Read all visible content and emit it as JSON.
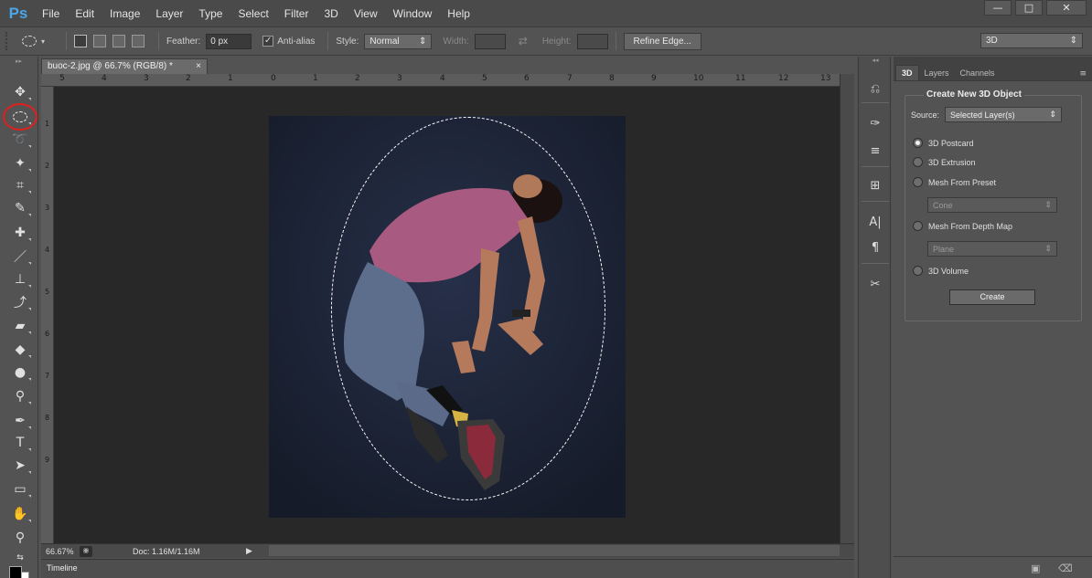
{
  "app": {
    "logo": "Ps",
    "menu": [
      "File",
      "Edit",
      "Image",
      "Layer",
      "Type",
      "Select",
      "Filter",
      "3D",
      "View",
      "Window",
      "Help"
    ],
    "window_controls": {
      "minimize": "—",
      "maximize": "□",
      "close": "✕"
    }
  },
  "options_bar": {
    "feather_label": "Feather:",
    "feather_value": "0 px",
    "antialias_label": "Anti-alias",
    "antialias_checked": true,
    "style_label": "Style:",
    "style_value": "Normal",
    "width_label": "Width:",
    "height_label": "Height:",
    "refine_edge_label": "Refine Edge...",
    "workspace_value": "3D"
  },
  "toolbar": {
    "tools": [
      "move-tool",
      "elliptical-marquee-tool",
      "lasso-tool",
      "quick-selection-tool",
      "crop-tool",
      "eyedropper-tool",
      "spot-healing-brush-tool",
      "brush-tool",
      "clone-stamp-tool",
      "history-brush-tool",
      "eraser-tool",
      "paint-bucket-tool",
      "blur-tool",
      "dodge-tool",
      "pen-tool",
      "type-tool",
      "path-selection-tool",
      "rectangle-tool",
      "hand-tool",
      "zoom-tool"
    ],
    "foreground_color": "#000000",
    "background_color": "#ffffff"
  },
  "annotation": {
    "color": "#e02020"
  },
  "document": {
    "tab_title": "buoc-2.jpg @ 66.7% (RGB/8) *",
    "tab_close": "×",
    "ruler_top": [
      "5",
      "4",
      "3",
      "2",
      "1",
      "0",
      "1",
      "2",
      "3",
      "4",
      "5",
      "6",
      "7",
      "8",
      "9",
      "10",
      "11",
      "12",
      "13"
    ],
    "ruler_left": [
      "1",
      "2",
      "3",
      "4",
      "5",
      "6",
      "7",
      "8",
      "9"
    ],
    "canvas_color": "#1e2431",
    "status_zoom": "66.67%",
    "status_doc": "Doc: 1.16M/1.16M",
    "timeline_label": "Timeline"
  },
  "panel": {
    "tabs": [
      "3D",
      "Layers",
      "Channels"
    ],
    "active_tab": "3D",
    "group_title": "Create New 3D Object",
    "source_label": "Source:",
    "source_value": "Selected Layer(s)",
    "options": [
      {
        "label": "3D Postcard",
        "selected": true
      },
      {
        "label": "3D Extrusion",
        "selected": false
      },
      {
        "label": "Mesh From Preset",
        "selected": false
      },
      {
        "label": "Mesh From Depth Map",
        "selected": false
      },
      {
        "label": "3D Volume",
        "selected": false
      }
    ],
    "preset_value": "Cone",
    "depth_map_value": "Plane",
    "create_label": "Create"
  }
}
